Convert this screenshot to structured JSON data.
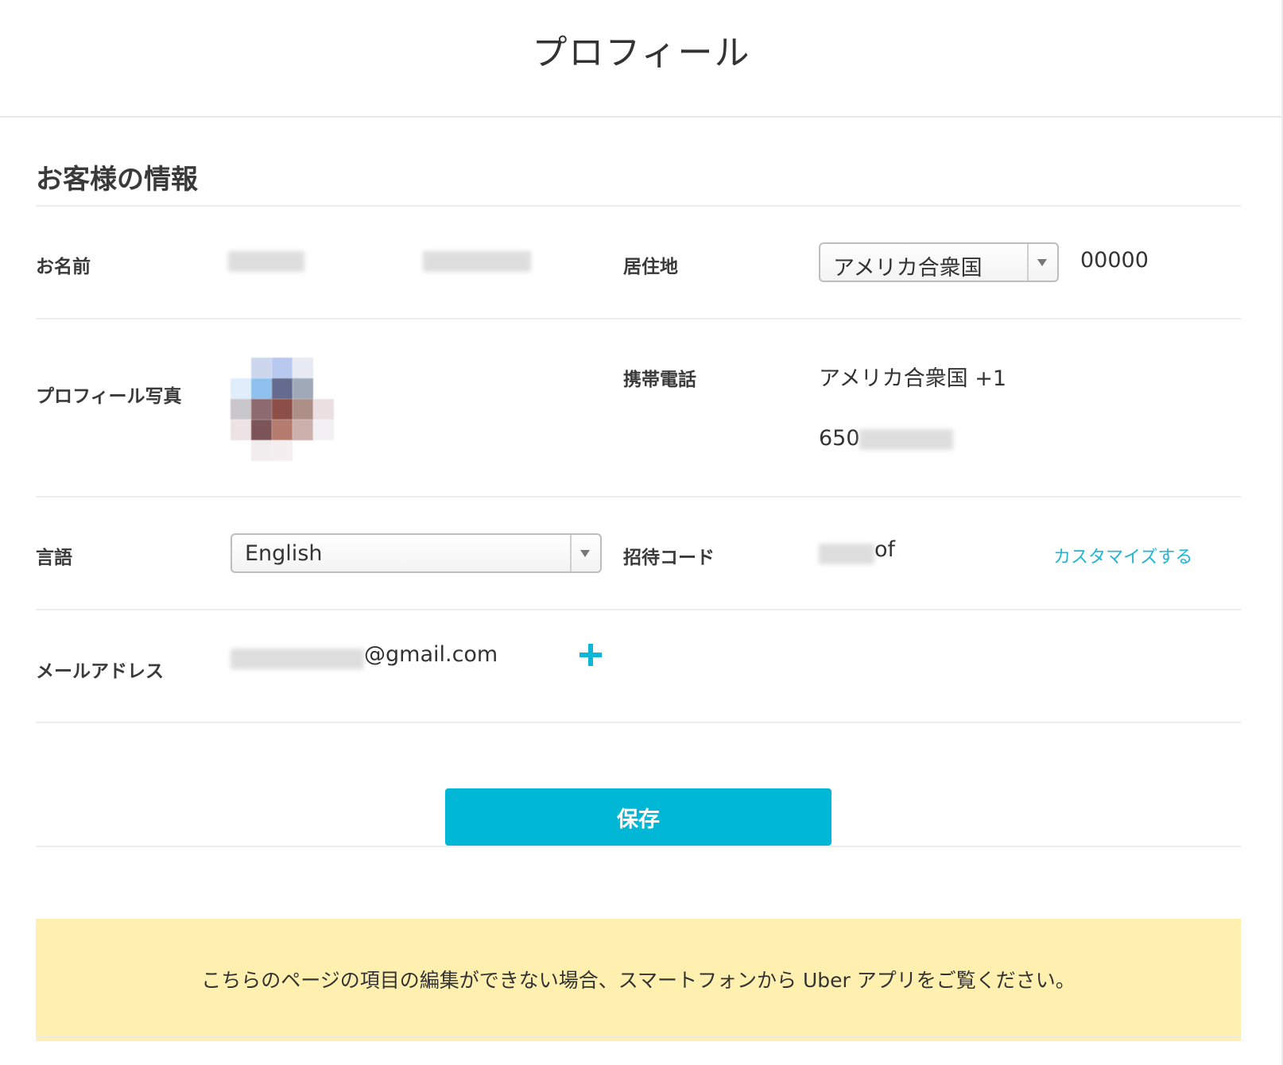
{
  "header": {
    "title": "プロフィール"
  },
  "section": {
    "title": "お客様の情報"
  },
  "fields": {
    "name_label": "お名前",
    "residence_label": "居住地",
    "residence_value": "アメリカ合衆国",
    "postal_code": "00000",
    "photo_label": "プロフィール写真",
    "phone_label": "携帯電話",
    "phone_country": "アメリカ合衆国 +1",
    "phone_number_prefix": "650",
    "language_label": "言語",
    "language_value": "English",
    "invite_label": "招待コード",
    "invite_code_suffix": "of",
    "customize_link": "カスタマイズする",
    "email_label": "メールアドレス",
    "email_domain": "@gmail.com"
  },
  "actions": {
    "save_label": "保存"
  },
  "notice": {
    "text": "こちらのページの項目の編集ができない場合、スマートフォンから Uber アプリをご覧ください。"
  },
  "colors": {
    "accent": "#00b8d6",
    "notice_bg": "#fff0b0"
  },
  "icons": {
    "add_email": "plus-icon",
    "select_arrow": "chevron-down-icon"
  }
}
